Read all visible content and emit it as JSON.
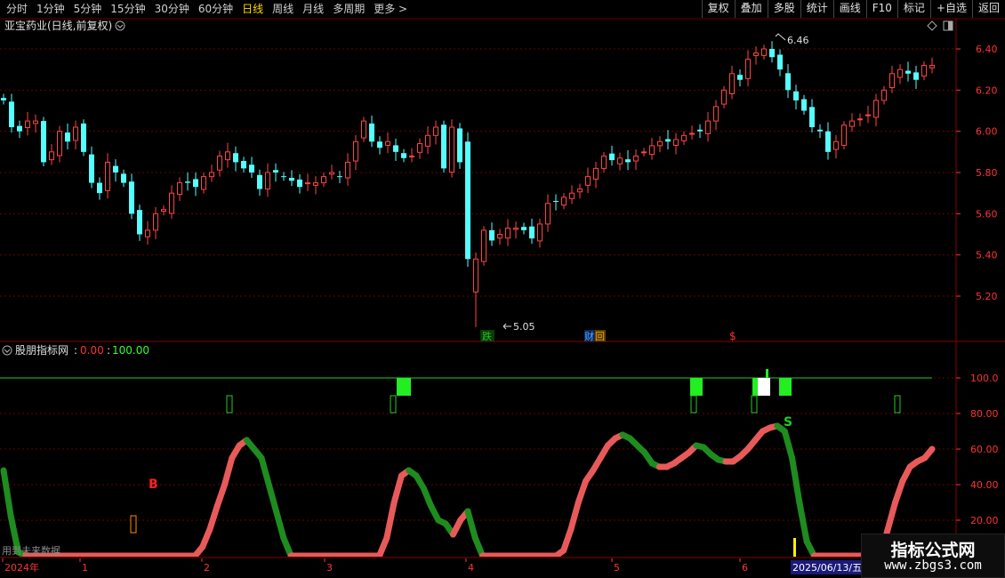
{
  "toolbar": {
    "periods": [
      "分时",
      "1分钟",
      "5分钟",
      "15分钟",
      "30分钟",
      "60分钟",
      "日线",
      "周线",
      "月线",
      "多周期",
      "更多 >"
    ],
    "active_period": "日线",
    "buttons": [
      "复权",
      "叠加",
      "多股",
      "统计",
      "画线",
      "F10",
      "标记",
      "+自选",
      "返回"
    ]
  },
  "price_panel": {
    "title": "亚宝药业(日线,前复权)",
    "high_label": "6.46",
    "low_label": "5.05",
    "y_ticks": [
      "6.40",
      "6.20",
      "6.00",
      "5.80",
      "5.60",
      "5.40",
      "5.20"
    ],
    "markers": [
      {
        "text": "跌",
        "color": "#22c022"
      },
      {
        "text": "财",
        "color": "#2a7fff"
      },
      {
        "text": "回",
        "color": "#e0a000"
      },
      {
        "text": "$",
        "color": "#ff3030"
      }
    ]
  },
  "indicator_panel": {
    "title": "股朋指标网",
    "value_red": "0.00",
    "value_green": "100.00",
    "y_ticks": [
      "100.0",
      "80.00",
      "60.00",
      "40.00",
      "20.00"
    ],
    "buy_label": "B",
    "sell_label": "S",
    "future_note": "用到未来数据"
  },
  "x_axis": {
    "labels": [
      "2024年",
      "1",
      "2",
      "3",
      "4",
      "5",
      "6"
    ],
    "date_box": "2025/06/13/五"
  },
  "watermark": {
    "name": "指标公式网",
    "url": "www.zbgs3.com"
  },
  "colors": {
    "up": "#ff4444",
    "down": "#54ffff",
    "grid": "#7a0000",
    "axis_text": "#ff3333",
    "line_red": "#e85a5a",
    "line_green": "#1e8c1e"
  },
  "chart_data": {
    "type": "candlestick",
    "title": "亚宝药业(日线,前复权)",
    "ylim": [
      5.05,
      6.5
    ],
    "x_months": [
      "2024年",
      "1",
      "2",
      "3",
      "4",
      "5",
      "6"
    ],
    "high": 6.46,
    "low": 5.05,
    "close_series": [
      6.15,
      6.02,
      6.0,
      6.05,
      6.05,
      5.85,
      5.9,
      6.0,
      5.95,
      6.02,
      5.9,
      5.75,
      5.7,
      5.85,
      5.8,
      5.75,
      5.6,
      5.5,
      5.52,
      5.6,
      5.62,
      5.7,
      5.75,
      5.75,
      5.73,
      5.78,
      5.8,
      5.88,
      5.9,
      5.85,
      5.82,
      5.8,
      5.72,
      5.8,
      5.8,
      5.78,
      5.76,
      5.73,
      5.75,
      5.75,
      5.78,
      5.8,
      5.78,
      5.85,
      5.95,
      6.05,
      5.95,
      5.92,
      5.95,
      5.9,
      5.87,
      5.88,
      5.94,
      5.98,
      6.02,
      5.82,
      6.02,
      5.85,
      5.38,
      5.38,
      5.52,
      5.47,
      5.5,
      5.53,
      5.53,
      5.52,
      5.48,
      5.55,
      5.65,
      5.66,
      5.68,
      5.7,
      5.72,
      5.78,
      5.82,
      5.88,
      5.86,
      5.87,
      5.85,
      5.88,
      5.9,
      5.93,
      5.95,
      5.95,
      5.96,
      5.98,
      5.99,
      6.0,
      6.05,
      6.12,
      6.2,
      6.28,
      6.25,
      6.35,
      6.38,
      6.4,
      6.36,
      6.3,
      6.2,
      6.15,
      6.1,
      6.02,
      6.0,
      5.9,
      5.95,
      6.03,
      6.05,
      6.06,
      6.08,
      6.15,
      6.2,
      6.28,
      6.3,
      6.28,
      6.25,
      6.32,
      6.32
    ],
    "oscillator": {
      "ylim": [
        0,
        100
      ],
      "series": [
        {
          "values": [
            48,
            22,
            2,
            0,
            0,
            0,
            0,
            0,
            0,
            0,
            0,
            0,
            0,
            0,
            0,
            0,
            0,
            0,
            0,
            0,
            0,
            0,
            0,
            0,
            0,
            0,
            0,
            5,
            15,
            28,
            40,
            55,
            62,
            65,
            60,
            55,
            40,
            25,
            10,
            0,
            0,
            0,
            0,
            0,
            0,
            0,
            0,
            0,
            0,
            0,
            0,
            0,
            10,
            30,
            45,
            48,
            45,
            38,
            28,
            20,
            18,
            12,
            20,
            25,
            10,
            0,
            0,
            0,
            0,
            0,
            0,
            0,
            0,
            0,
            0,
            0,
            3,
            15,
            30,
            42,
            48,
            55,
            62,
            66,
            68,
            66,
            62,
            58,
            52,
            50,
            50,
            52,
            55,
            58,
            62,
            61,
            57,
            54,
            53,
            53,
            56,
            60,
            65,
            70,
            72,
            73,
            70,
            55,
            30,
            8,
            0,
            0,
            0,
            0,
            0,
            0,
            0,
            0,
            0,
            0,
            15,
            30,
            42,
            50,
            53,
            55,
            60
          ]
        }
      ],
      "reference_line": 100,
      "buy_signal": "B",
      "sell_signal": "S"
    }
  }
}
